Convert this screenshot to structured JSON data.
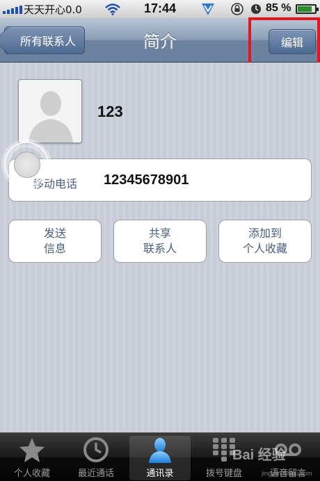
{
  "status_bar": {
    "carrier": "天天开心0.0",
    "time": "17:44",
    "battery_percent_label": "85 %",
    "battery_level": 0.85
  },
  "nav": {
    "back_label": "所有联系人",
    "title": "简介",
    "edit_label": "编辑"
  },
  "contact": {
    "name": "123",
    "phone_label": "移动电话",
    "phone_value": "12345678901"
  },
  "actions": [
    {
      "line1": "发送",
      "line2": "信息"
    },
    {
      "line1": "共享",
      "line2": "联系人"
    },
    {
      "line1": "添加到",
      "line2": "个人收藏"
    }
  ],
  "tabs": [
    {
      "label": "个人收藏",
      "icon": "star-icon"
    },
    {
      "label": "最近通话",
      "icon": "clock-icon"
    },
    {
      "label": "通讯录",
      "icon": "contacts-icon",
      "active": true
    },
    {
      "label": "拨号键盘",
      "icon": "keypad-icon"
    },
    {
      "label": "语音留言",
      "icon": "voicemail-icon"
    }
  ],
  "watermark": {
    "main": "Bai 经验",
    "sub": "jingyan.baidu.com"
  },
  "colors": {
    "highlight": "#e8141b",
    "nav_blue": "#6b82a0"
  }
}
